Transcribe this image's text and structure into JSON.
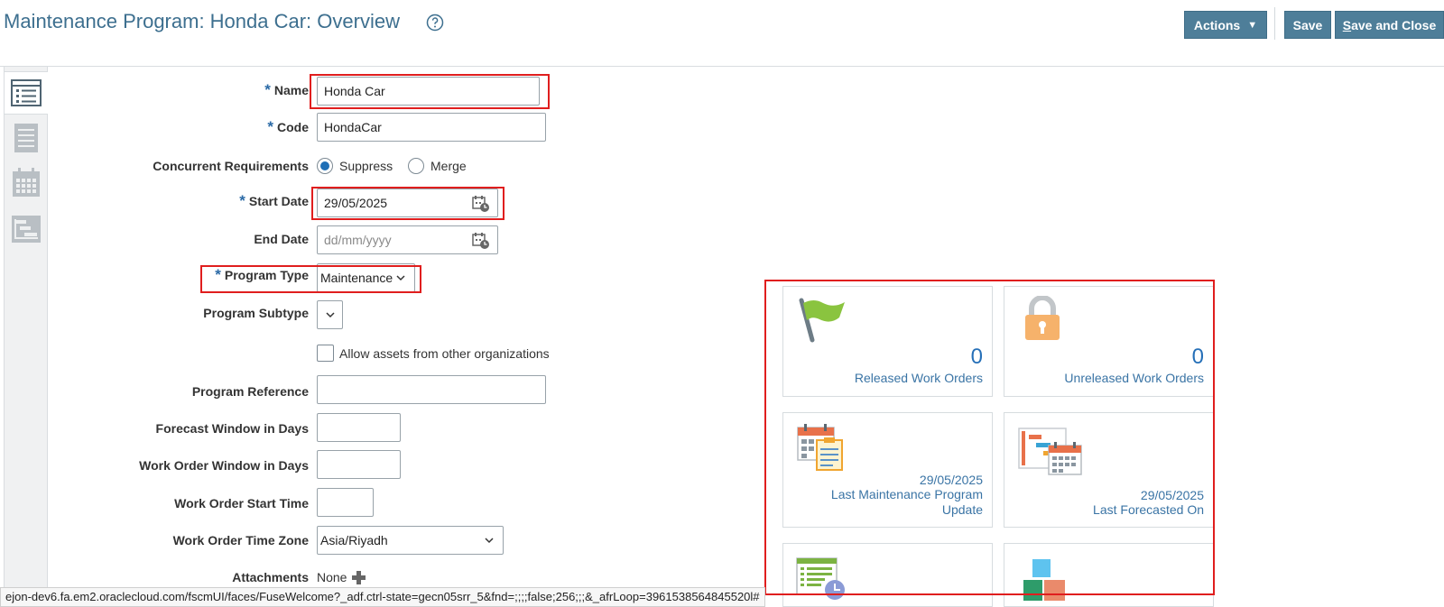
{
  "header": {
    "title": "Maintenance Program: Honda Car: Overview",
    "actions_label": "Actions",
    "save_label": "Save",
    "save_close_label": "Save and Close",
    "save_close_mnemonic": "S",
    "save_close_rest": "ave and Close"
  },
  "rail": {
    "items": [
      {
        "name": "overview",
        "icon": "list-detail-icon",
        "active": true
      },
      {
        "name": "details",
        "icon": "document-lines-icon",
        "active": false
      },
      {
        "name": "calendar",
        "icon": "calendar-icon",
        "active": false
      },
      {
        "name": "gantt",
        "icon": "gantt-chart-icon",
        "active": false
      }
    ]
  },
  "form": {
    "name": {
      "label": "Name",
      "required": true,
      "value": "Honda Car"
    },
    "code": {
      "label": "Code",
      "required": true,
      "value": "HondaCar"
    },
    "concurrent": {
      "label": "Concurrent Requirements",
      "options": [
        "Suppress",
        "Merge"
      ],
      "selected": "Suppress"
    },
    "start_date": {
      "label": "Start Date",
      "required": true,
      "value": "29/05/2025"
    },
    "end_date": {
      "label": "End Date",
      "placeholder": "dd/mm/yyyy"
    },
    "program_type": {
      "label": "Program Type",
      "required": true,
      "value": "Maintenance"
    },
    "program_subtype": {
      "label": "Program Subtype",
      "value": ""
    },
    "allow_assets": {
      "label": "Allow assets from other organizations",
      "checked": false
    },
    "program_reference": {
      "label": "Program Reference",
      "value": ""
    },
    "forecast_window": {
      "label": "Forecast Window in Days",
      "value": ""
    },
    "work_order_window": {
      "label": "Work Order Window in Days",
      "value": ""
    },
    "work_order_start_time": {
      "label": "Work Order Start Time",
      "value": ""
    },
    "work_order_time_zone": {
      "label": "Work Order Time Zone",
      "value": "Asia/Riyadh"
    },
    "attachments": {
      "label": "Attachments",
      "value": "None"
    }
  },
  "tiles": {
    "released": {
      "count": "0",
      "label": "Released Work Orders",
      "icon": "green-flag-icon"
    },
    "unreleased": {
      "count": "0",
      "label": "Unreleased Work Orders",
      "icon": "padlock-icon"
    },
    "last_update": {
      "date": "29/05/2025",
      "label_line1": "Last Maintenance Program",
      "label_line2": "Update",
      "icon": "calendar-clipboard-icon"
    },
    "last_forecast": {
      "date": "29/05/2025",
      "label": "Last Forecasted On",
      "icon": "gantt-calendar-icon"
    },
    "tile5": {
      "icon": "list-clock-icon"
    },
    "tile6": {
      "icon": "colored-blocks-icon"
    }
  },
  "status_bar": {
    "url": "ejon-dev6.fa.em2.oraclecloud.com/fscmUI/faces/FuseWelcome?_adf.ctrl-state=gecn05srr_5&fnd=;;;;false;256;;;&_afrLoop=3961538564845520l#"
  },
  "colors": {
    "accent": "#4e7e99",
    "title": "#3d6f8f",
    "link": "#3a74a5",
    "highlight": "#e01e1e",
    "required": "#2b6aa6"
  }
}
